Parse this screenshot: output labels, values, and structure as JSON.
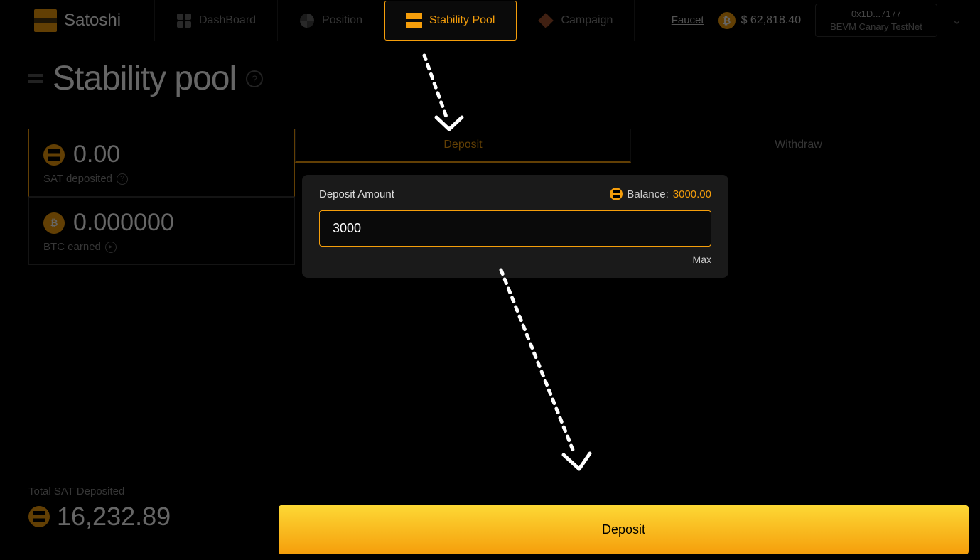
{
  "brand": {
    "name": "Satoshi"
  },
  "nav": {
    "dashboard": "DashBoard",
    "position": "Position",
    "stability_pool": "Stability Pool",
    "campaign": "Campaign"
  },
  "header": {
    "faucet": "Faucet",
    "btc_price": "$ 62,818.40",
    "wallet_address": "0x1D...7177",
    "network": "BEVM Canary TestNet"
  },
  "page": {
    "title": "Stability pool"
  },
  "stats": {
    "sat_deposited_value": "0.00",
    "sat_deposited_label": "SAT deposited",
    "btc_earned_value": "0.000000",
    "btc_earned_label": "BTC earned"
  },
  "tabs": {
    "deposit": "Deposit",
    "withdraw": "Withdraw"
  },
  "deposit_form": {
    "amount_label": "Deposit Amount",
    "balance_label": "Balance:",
    "balance_value": "3000.00",
    "input_value": "3000",
    "max": "Max"
  },
  "totals": {
    "label": "Total SAT Deposited",
    "value": "16,232.89"
  },
  "actions": {
    "deposit_button": "Deposit"
  }
}
